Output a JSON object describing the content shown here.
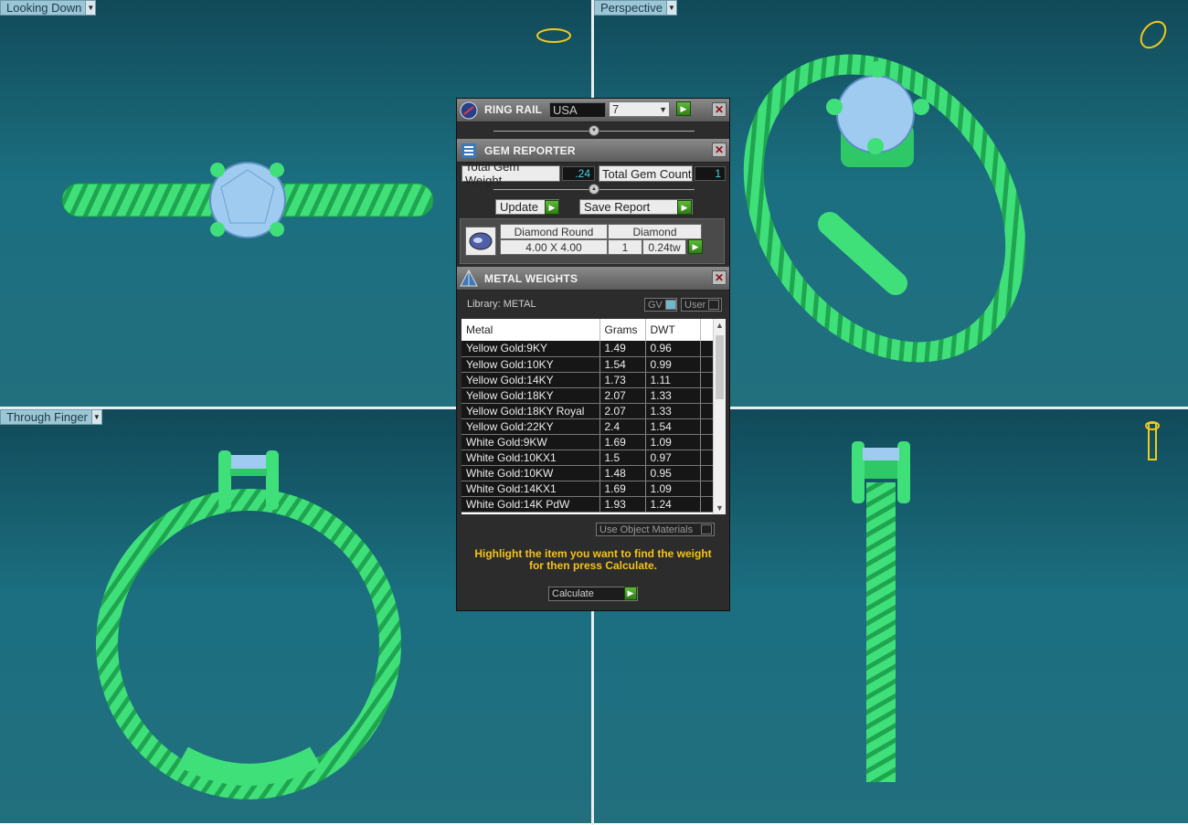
{
  "views": {
    "top_left_label": "Looking Down",
    "top_right_label": "Perspective",
    "bottom_left_label": "Through Finger"
  },
  "ring_rail": {
    "title": "RING RAIL",
    "region": "USA",
    "size": "7"
  },
  "gem_reporter": {
    "title": "GEM REPORTER",
    "total_weight_label": "Total Gem Weight",
    "total_weight_value": ".24",
    "total_count_label": "Total Gem Count",
    "total_count_value": "1",
    "update_label": "Update",
    "save_report_label": "Save Report",
    "gem": {
      "shape": "Diamond Round",
      "dimensions": "4.00 X 4.00",
      "type": "Diamond",
      "count": "1",
      "weight": "0.24tw"
    }
  },
  "metal_weights": {
    "title": "METAL WEIGHTS",
    "library_label": "Library: METAL",
    "toggle_gv": "GV",
    "toggle_user": "User",
    "columns": [
      "Metal",
      "Grams",
      "DWT"
    ],
    "rows": [
      [
        "Yellow Gold:9KY",
        "1.49",
        "0.96"
      ],
      [
        "Yellow Gold:10KY",
        "1.54",
        "0.99"
      ],
      [
        "Yellow Gold:14KY",
        "1.73",
        "1.11"
      ],
      [
        "Yellow Gold:18KY",
        "2.07",
        "1.33"
      ],
      [
        "Yellow Gold:18KY Royal",
        "2.07",
        "1.33"
      ],
      [
        "Yellow Gold:22KY",
        "2.4",
        "1.54"
      ],
      [
        "White Gold:9KW",
        "1.69",
        "1.09"
      ],
      [
        "White Gold:10KX1",
        "1.5",
        "0.97"
      ],
      [
        "White Gold:10KW",
        "1.48",
        "0.95"
      ],
      [
        "White Gold:14KX1",
        "1.69",
        "1.09"
      ],
      [
        "White Gold:14K PdW",
        "1.93",
        "1.24"
      ]
    ],
    "use_object_materials_label": "Use Object Materials",
    "hint_text": "Highlight the item you want to find the weight for then press Calculate.",
    "calculate_label": "Calculate"
  }
}
